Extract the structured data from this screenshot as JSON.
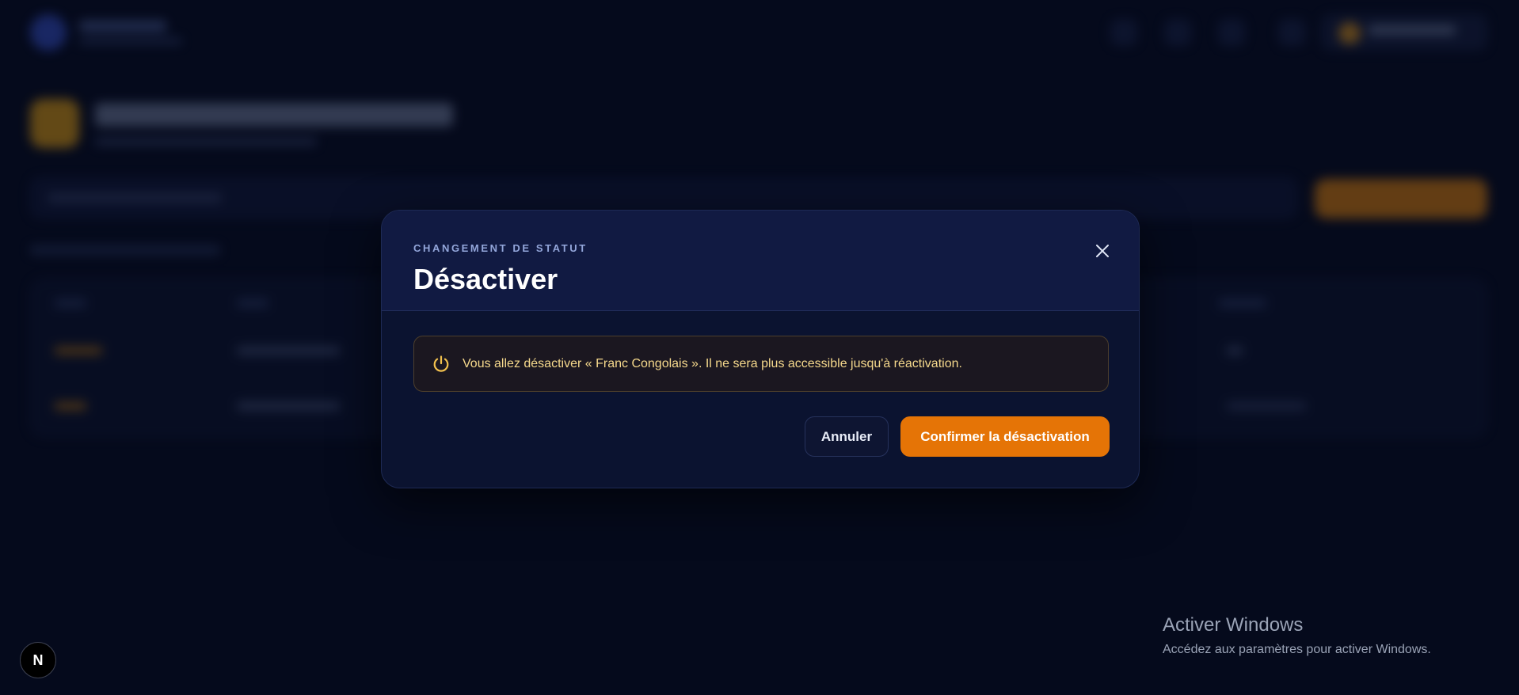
{
  "modal": {
    "eyebrow": "CHANGEMENT DE STATUT",
    "title": "Désactiver",
    "close_icon": "close-icon",
    "alert": {
      "icon": "power-icon",
      "text": "Vous allez désactiver « Franc Congolais ». Il ne sera plus accessible jusqu'à réactivation."
    },
    "cancel_label": "Annuler",
    "confirm_label": "Confirmer la désactivation"
  },
  "watermark": {
    "title": "Activer Windows",
    "subtitle": "Accédez aux paramètres pour activer Windows."
  },
  "dev_badge": {
    "label": "N"
  },
  "colors": {
    "background": "#050a1c",
    "modal_bg": "#0b1330",
    "modal_header_bg": "#111a42",
    "accent_orange": "#e57406",
    "alert_text": "#f6d98c",
    "alert_icon": "#f2c14e"
  }
}
